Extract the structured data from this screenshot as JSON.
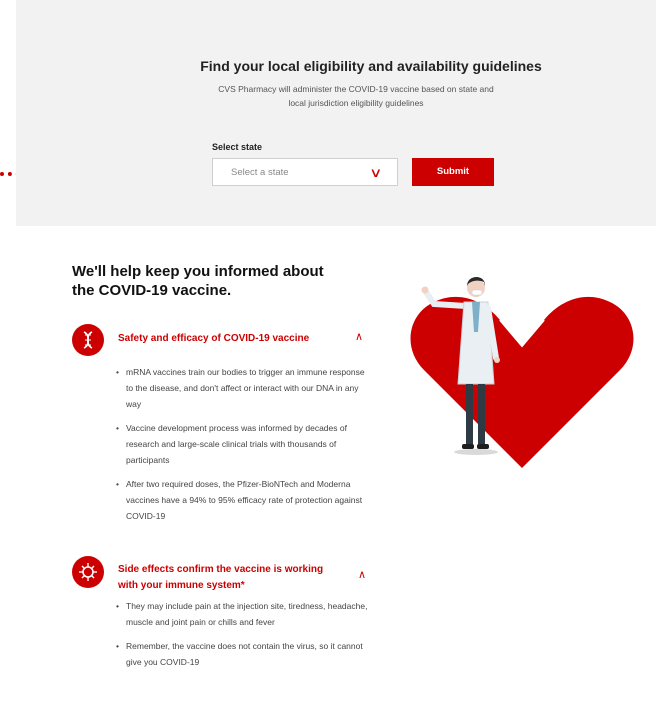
{
  "colors": {
    "brand_red": "#cc0000",
    "banner_bg": "#f2f2f2"
  },
  "banner": {
    "title": "Find your local eligibility and availability guidelines",
    "subtitle": "CVS Pharmacy will administer the COVID-19 vaccine based on state and local jurisdiction eligibility guidelines",
    "state_label": "Select state",
    "state_placeholder": "Select a state",
    "submit_label": "Submit"
  },
  "info": {
    "heading": "We'll help keep you informed about the COVID-19 vaccine.",
    "sections": [
      {
        "icon": "dna-icon",
        "title": "Safety and efficacy of COVID-19 vaccine",
        "bullets": [
          "mRNA vaccines train our bodies to trigger an immune response to the disease, and don't affect or interact with our DNA in any way",
          "Vaccine development process was informed by decades of research and large-scale clinical trials with thousands of participants",
          "After two required doses, the Pfizer-BioNTech and Moderna vaccines have a 94% to 95% efficacy rate of protection against COVID-19"
        ]
      },
      {
        "icon": "virus-icon",
        "title": "Side effects confirm the vaccine is working with your immune system*",
        "bullets": [
          "They may include pain at the injection site, tiredness, headache, muscle and joint pain or chills and fever",
          "Remember, the vaccine does not contain the virus, so it cannot give you COVID-19"
        ]
      }
    ]
  }
}
